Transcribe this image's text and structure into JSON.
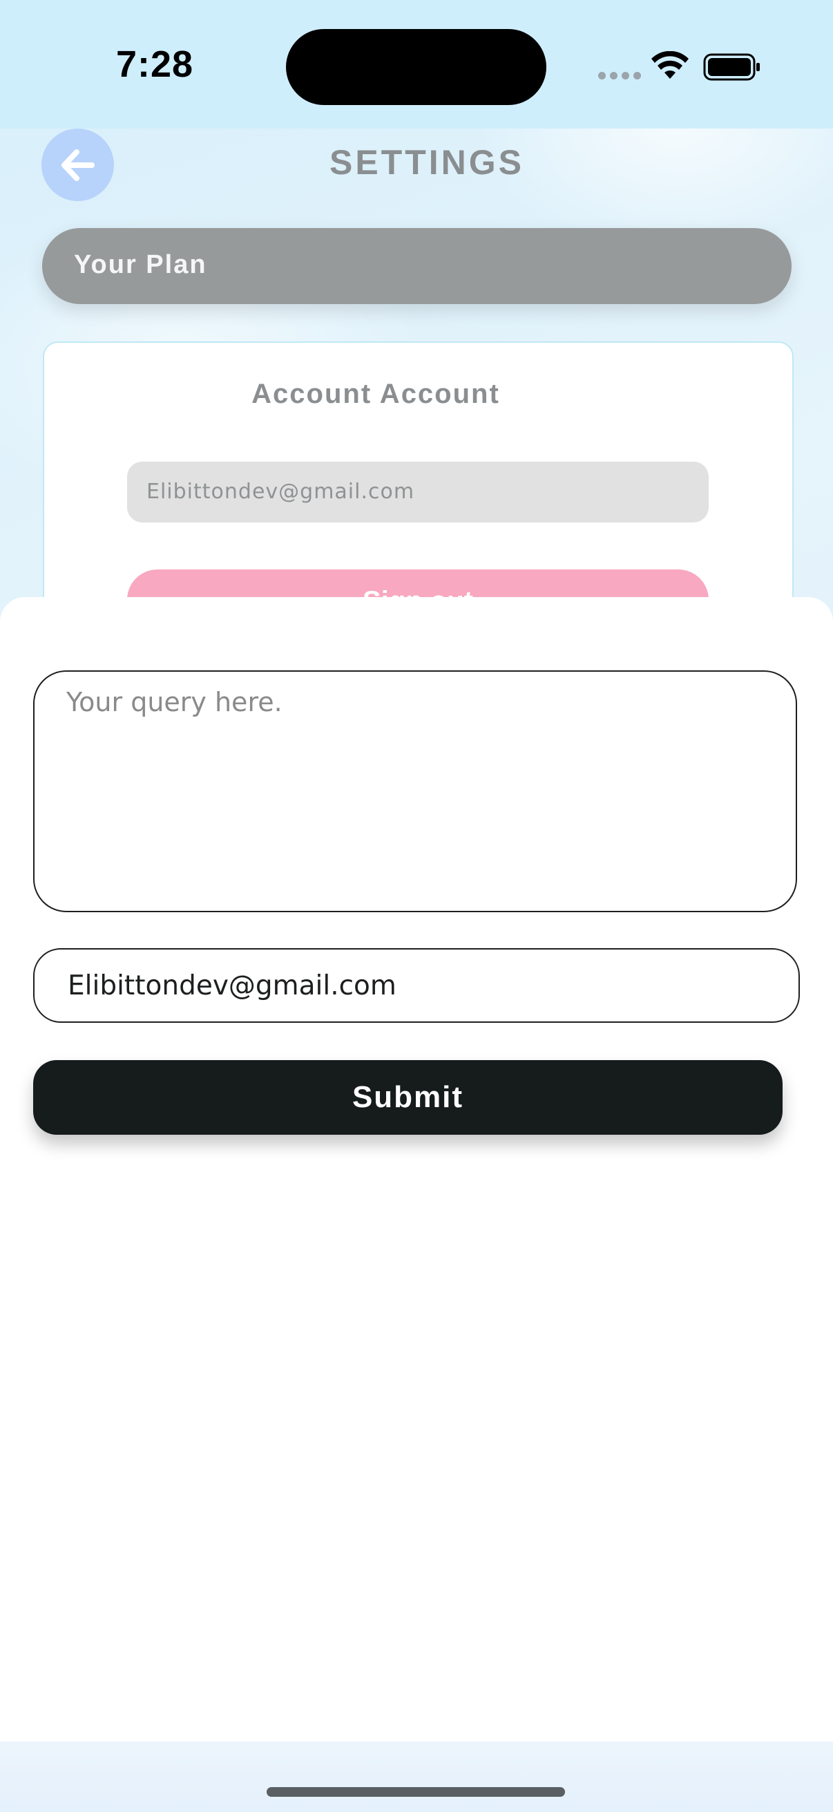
{
  "status_bar": {
    "time": "7:28"
  },
  "header": {
    "title": "SETTINGS",
    "back_icon": "arrow-left-icon"
  },
  "plan": {
    "label": "Your Plan"
  },
  "account_card": {
    "title": "Account Account",
    "email": "Elibittondev@gmail.com",
    "action_label": "Sign out"
  },
  "form": {
    "query_placeholder": "Your query here.",
    "query_value": "",
    "email_value": "Elibittondev@gmail.com",
    "submit_label": "Submit"
  },
  "colors": {
    "back_button": "#b7d3fb",
    "plan_pill": "#979a9b",
    "action_button": "#f8a8c0",
    "submit_button": "#161b1c"
  }
}
